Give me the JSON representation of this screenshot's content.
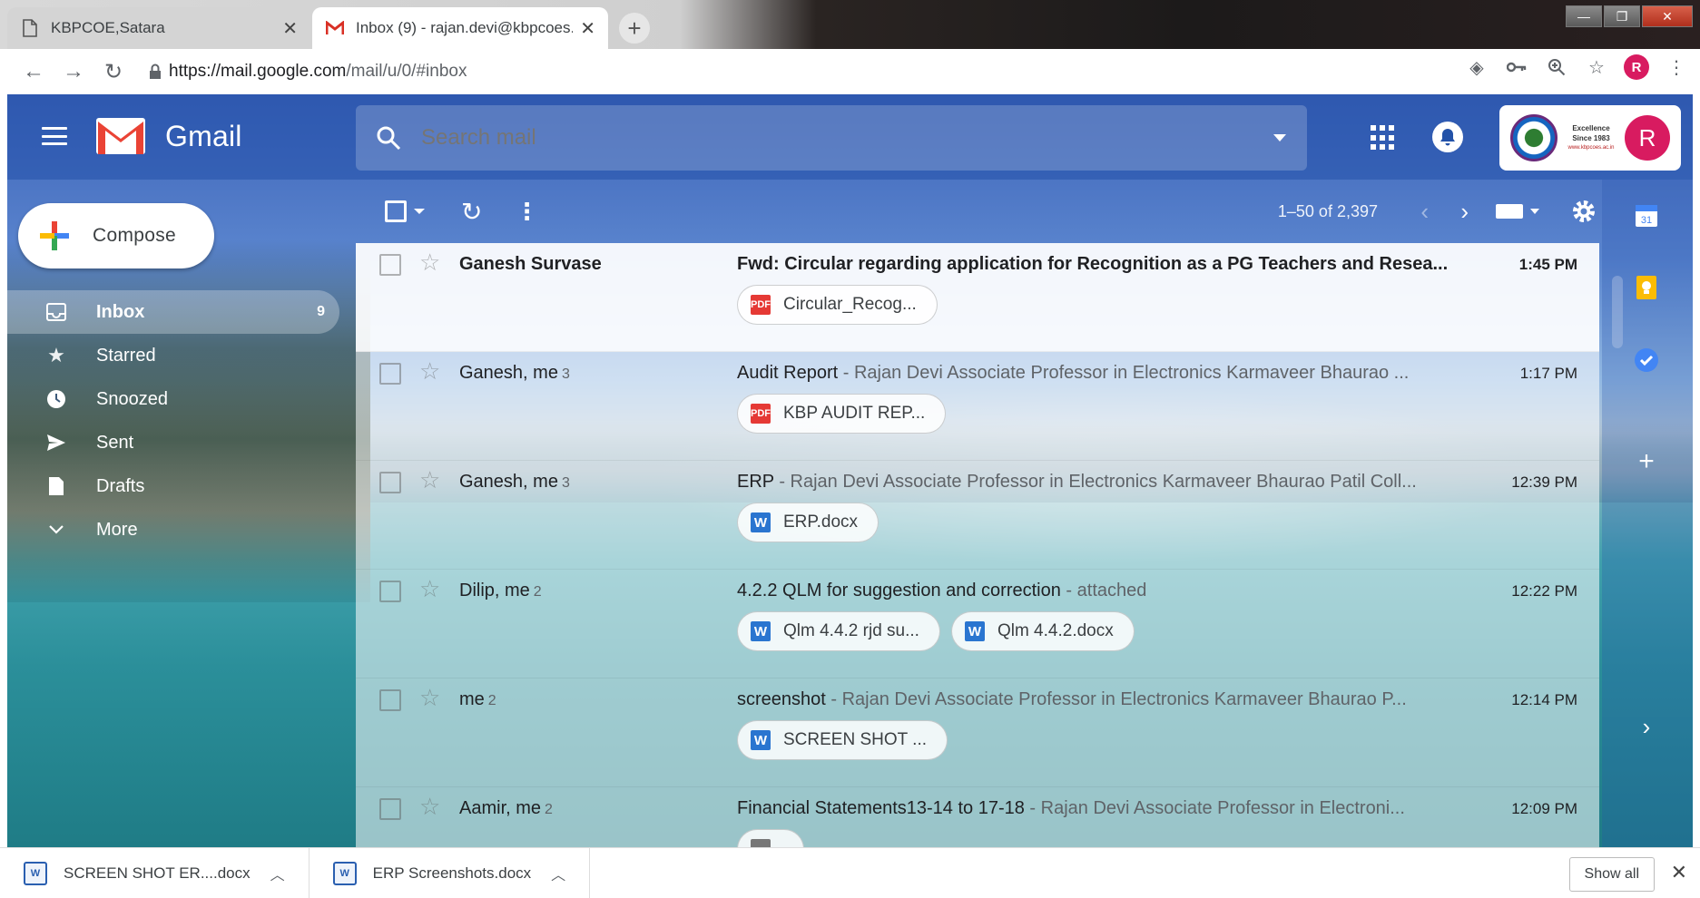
{
  "browser": {
    "tabs": [
      {
        "title": "KBPCOE,Satara",
        "active": false
      },
      {
        "title": "Inbox (9) - rajan.devi@kbpcoes.e",
        "active": true
      }
    ],
    "url": {
      "prefix": "https://mail.google.com",
      "path": "/mail/u/0/#inbox"
    },
    "profile_initial": "R"
  },
  "gmail": {
    "logo_text": "Gmail",
    "search_placeholder": "Search mail",
    "org": {
      "line1": "Excellence",
      "line2": "Since 1983",
      "site": "www.kbpcoes.ac.in"
    },
    "avatar_initial": "R",
    "compose_label": "Compose",
    "nav": [
      {
        "label": "Inbox",
        "count": "9",
        "icon": "inbox-icon",
        "active": true
      },
      {
        "label": "Starred",
        "count": "",
        "icon": "star-icon",
        "active": false
      },
      {
        "label": "Snoozed",
        "count": "",
        "icon": "clock-icon",
        "active": false
      },
      {
        "label": "Sent",
        "count": "",
        "icon": "send-icon",
        "active": false
      },
      {
        "label": "Drafts",
        "count": "",
        "icon": "draft-icon",
        "active": false
      },
      {
        "label": "More",
        "count": "",
        "icon": "chevron-down-icon",
        "active": false
      }
    ],
    "pagination": "1–50 of 2,397",
    "emails": [
      {
        "sender": "Ganesh Survase",
        "count": "",
        "subject": "Fwd: Circular regarding application for Recognition as a PG Teachers and Resea...",
        "snippet": "",
        "time": "1:45 PM",
        "unread": true,
        "attachments": [
          {
            "name": "Circular_Recog...",
            "type": "pdf"
          }
        ]
      },
      {
        "sender": "Ganesh, me",
        "count": "3",
        "subject": "Audit Report",
        "snippet": " - Rajan Devi Associate Professor in Electronics Karmaveer Bhaurao ...",
        "time": "1:17 PM",
        "unread": false,
        "attachments": [
          {
            "name": "KBP AUDIT REP...",
            "type": "pdf"
          }
        ]
      },
      {
        "sender": "Ganesh, me",
        "count": "3",
        "subject": "ERP",
        "snippet": " - Rajan Devi Associate Professor in Electronics Karmaveer Bhaurao Patil Coll...",
        "time": "12:39 PM",
        "unread": false,
        "attachments": [
          {
            "name": "ERP.docx",
            "type": "word"
          }
        ]
      },
      {
        "sender": "Dilip, me",
        "count": "2",
        "subject": "4.2.2 QLM for suggestion and correction",
        "snippet": " - attached",
        "time": "12:22 PM",
        "unread": false,
        "attachments": [
          {
            "name": "Qlm 4.4.2 rjd su...",
            "type": "word"
          },
          {
            "name": "Qlm 4.4.2.docx",
            "type": "word"
          }
        ]
      },
      {
        "sender": "me",
        "count": "2",
        "subject": "screenshot",
        "snippet": " - Rajan Devi Associate Professor in Electronics Karmaveer Bhaurao P...",
        "time": "12:14 PM",
        "unread": false,
        "attachments": [
          {
            "name": "SCREEN SHOT ...",
            "type": "word"
          }
        ]
      },
      {
        "sender": "Aamir, me",
        "count": "2",
        "subject": "Financial Statements13-14 to 17-18",
        "snippet": " - Rajan Devi Associate Professor in Electroni...",
        "time": "12:09 PM",
        "unread": false,
        "attachments": [
          {
            "name": "",
            "type": "grey"
          }
        ]
      }
    ]
  },
  "rail": {
    "calendar_day": "31"
  },
  "downloads": {
    "items": [
      {
        "name": "SCREEN SHOT ER....docx"
      },
      {
        "name": "ERP Screenshots.docx"
      }
    ],
    "show_all_label": "Show all"
  }
}
